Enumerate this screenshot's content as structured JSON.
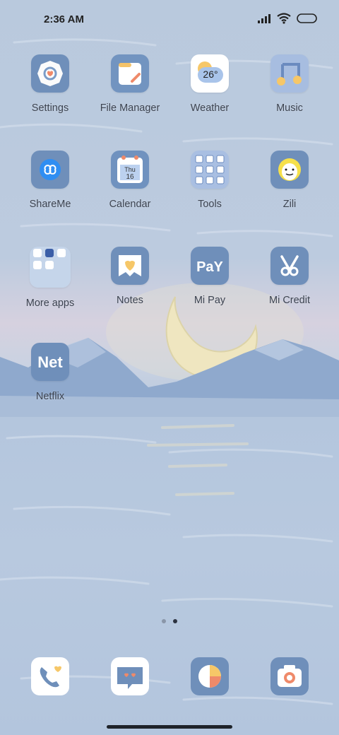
{
  "status_bar": {
    "time": "2:36 AM",
    "icons": [
      "signal-icon",
      "wifi-icon",
      "battery-icon"
    ]
  },
  "apps": [
    {
      "label": "Settings",
      "icon": "settings-icon"
    },
    {
      "label": "File Manager",
      "icon": "file-manager-icon"
    },
    {
      "label": "Weather",
      "icon": "weather-icon",
      "temperature": "26°"
    },
    {
      "label": "Music",
      "icon": "music-icon"
    },
    {
      "label": "ShareMe",
      "icon": "shareme-icon"
    },
    {
      "label": "Calendar",
      "icon": "calendar-icon",
      "day": "Thu",
      "date": "16"
    },
    {
      "label": "Tools",
      "icon": "tools-icon"
    },
    {
      "label": "Zili",
      "icon": "zili-icon"
    },
    {
      "label": "More apps",
      "icon": "more-apps-icon"
    },
    {
      "label": "Notes",
      "icon": "notes-icon"
    },
    {
      "label": "Mi Pay",
      "icon": "mi-pay-icon",
      "text": "PaY"
    },
    {
      "label": "Mi Credit",
      "icon": "mi-credit-icon"
    },
    {
      "label": "Netflix",
      "icon": "netflix-icon",
      "text": "Net"
    }
  ],
  "page_indicator": {
    "pages": 2,
    "active": 2
  },
  "dock": [
    {
      "icon": "phone-icon"
    },
    {
      "icon": "messages-icon"
    },
    {
      "icon": "browser-icon"
    },
    {
      "icon": "camera-icon"
    }
  ],
  "colors": {
    "sky": "#c4d3e6",
    "water": "#b5c7de",
    "mountain": "#8fa9cd",
    "moon": "#efe6c0",
    "icon_bg": "#6f8fba"
  }
}
